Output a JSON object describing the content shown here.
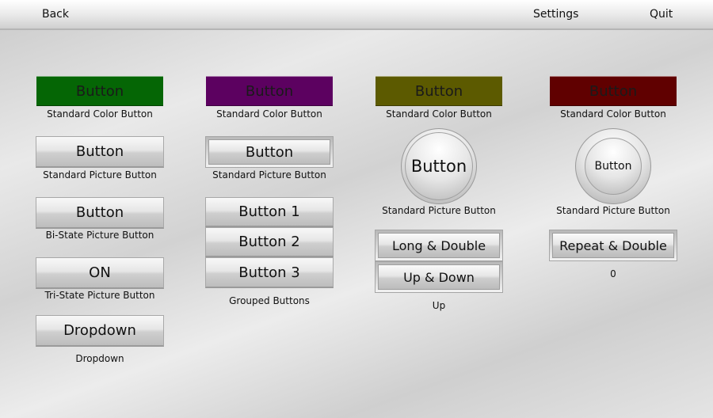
{
  "topbar": {
    "back": "Back",
    "settings": "Settings",
    "quit": "Quit"
  },
  "colors": {
    "green": "#056605",
    "purple": "#5c0160",
    "olive": "#5c5a00",
    "maroon": "#600000"
  },
  "col1": {
    "color_button": "Button",
    "color_caption": "Standard Color Button",
    "picture_button": "Button",
    "picture_caption": "Standard Picture Button",
    "bistate_button": "Button",
    "bistate_caption": "Bi-State Picture Button",
    "tristate_button": "ON",
    "tristate_caption": "Tri-State Picture Button",
    "dropdown_button": "Dropdown",
    "dropdown_caption": "Dropdown"
  },
  "col2": {
    "color_button": "Button",
    "color_caption": "Standard Color Button",
    "picture_button": "Button",
    "picture_caption": "Standard Picture Button",
    "group": [
      "Button 1",
      "Button 2",
      "Button 3"
    ],
    "group_caption": "Grouped Buttons"
  },
  "col3": {
    "color_button": "Button",
    "color_caption": "Standard Color Button",
    "round_button": "Button",
    "round_caption": "Standard Picture Button",
    "long_double": "Long & Double",
    "up_down": "Up & Down",
    "status": "Up"
  },
  "col4": {
    "color_button": "Button",
    "color_caption": "Standard Color Button",
    "round_button": "Button",
    "round_caption": "Standard Picture Button",
    "repeat_double": "Repeat & Double",
    "counter": "0"
  }
}
